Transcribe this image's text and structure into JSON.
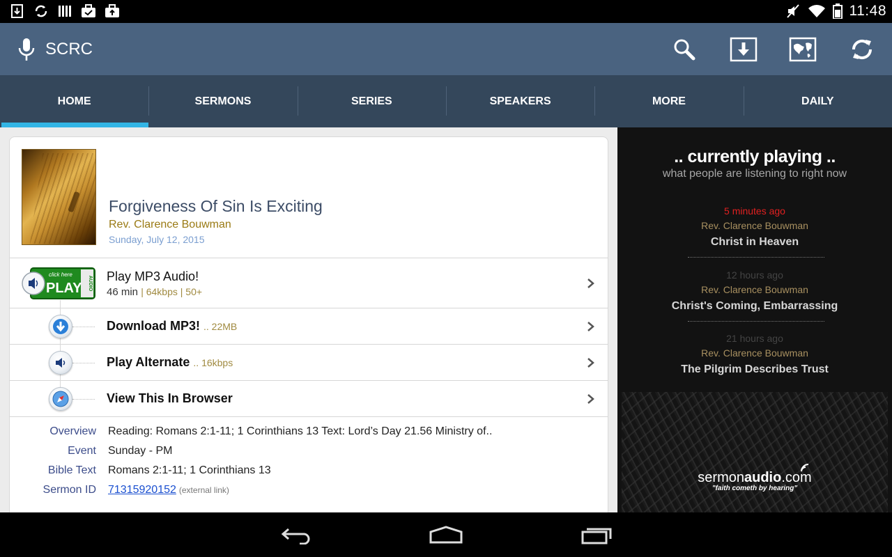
{
  "status_bar": {
    "time": "11:48"
  },
  "action_bar": {
    "title": "SCRC",
    "icons": [
      "search-icon",
      "download-icon",
      "map-icon",
      "refresh-icon"
    ]
  },
  "tabs": [
    {
      "label": "HOME",
      "active": true
    },
    {
      "label": "SERMONS",
      "active": false
    },
    {
      "label": "SERIES",
      "active": false
    },
    {
      "label": "SPEAKERS",
      "active": false
    },
    {
      "label": "MORE",
      "active": false
    },
    {
      "label": "DAILY",
      "active": false
    }
  ],
  "sermon": {
    "title": "Forgiveness Of Sin Is Exciting",
    "speaker": "Rev. Clarence Bouwman",
    "date": "Sunday, July 12, 2015"
  },
  "actions": {
    "play_mp3": {
      "label": "Play MP3 Audio!",
      "duration": "46 min",
      "meta": "| 64kbps | 50+",
      "badge_small": "click here",
      "badge_big": "PLAY",
      "badge_side": "AUDIO"
    },
    "download": {
      "label": "Download MP3!",
      "meta": ".. 22MB"
    },
    "alternate": {
      "label": "Play Alternate",
      "meta": ".. 16kbps"
    },
    "browser": {
      "label": "View This In Browser"
    }
  },
  "details": {
    "overview_label": "Overview",
    "overview": "Reading: Romans 2:1-11; 1 Corinthians 13 Text: Lord’s Day 21.56 Ministry of..",
    "event_label": "Event",
    "event": "Sunday - PM",
    "bible_label": "Bible Text",
    "bible": "Romans 2:1-11; 1 Corinthians 13",
    "id_label": "Sermon ID",
    "id": "71315920152",
    "id_note": "(external link)"
  },
  "now_playing": {
    "title": ".. currently playing ..",
    "subtitle": "what people are listening to right now",
    "items": [
      {
        "time": "5 minutes ago",
        "speaker": "Rev. Clarence Bouwman",
        "title": "Christ in Heaven",
        "time_color": "#e02020"
      },
      {
        "time": "12 hours ago",
        "speaker": "Rev. Clarence Bouwman",
        "title": "Christ's Coming, Embarrassing",
        "time_color": "#444444"
      },
      {
        "time": "21 hours ago",
        "speaker": "Rev. Clarence Bouwman",
        "title": "The Pilgrim Describes Trust",
        "time_color": "#444444"
      }
    ],
    "brand_left": "sermon",
    "brand_bold": "audio",
    "brand_right": ".com",
    "brand_tagline": "\"faith cometh by hearing\""
  },
  "colors": {
    "action_bar": "#4a6380",
    "tab_bar": "#34475b",
    "tab_indicator": "#33b5e5",
    "title_text": "#3c4c66",
    "speaker_text": "#9a7a14"
  }
}
